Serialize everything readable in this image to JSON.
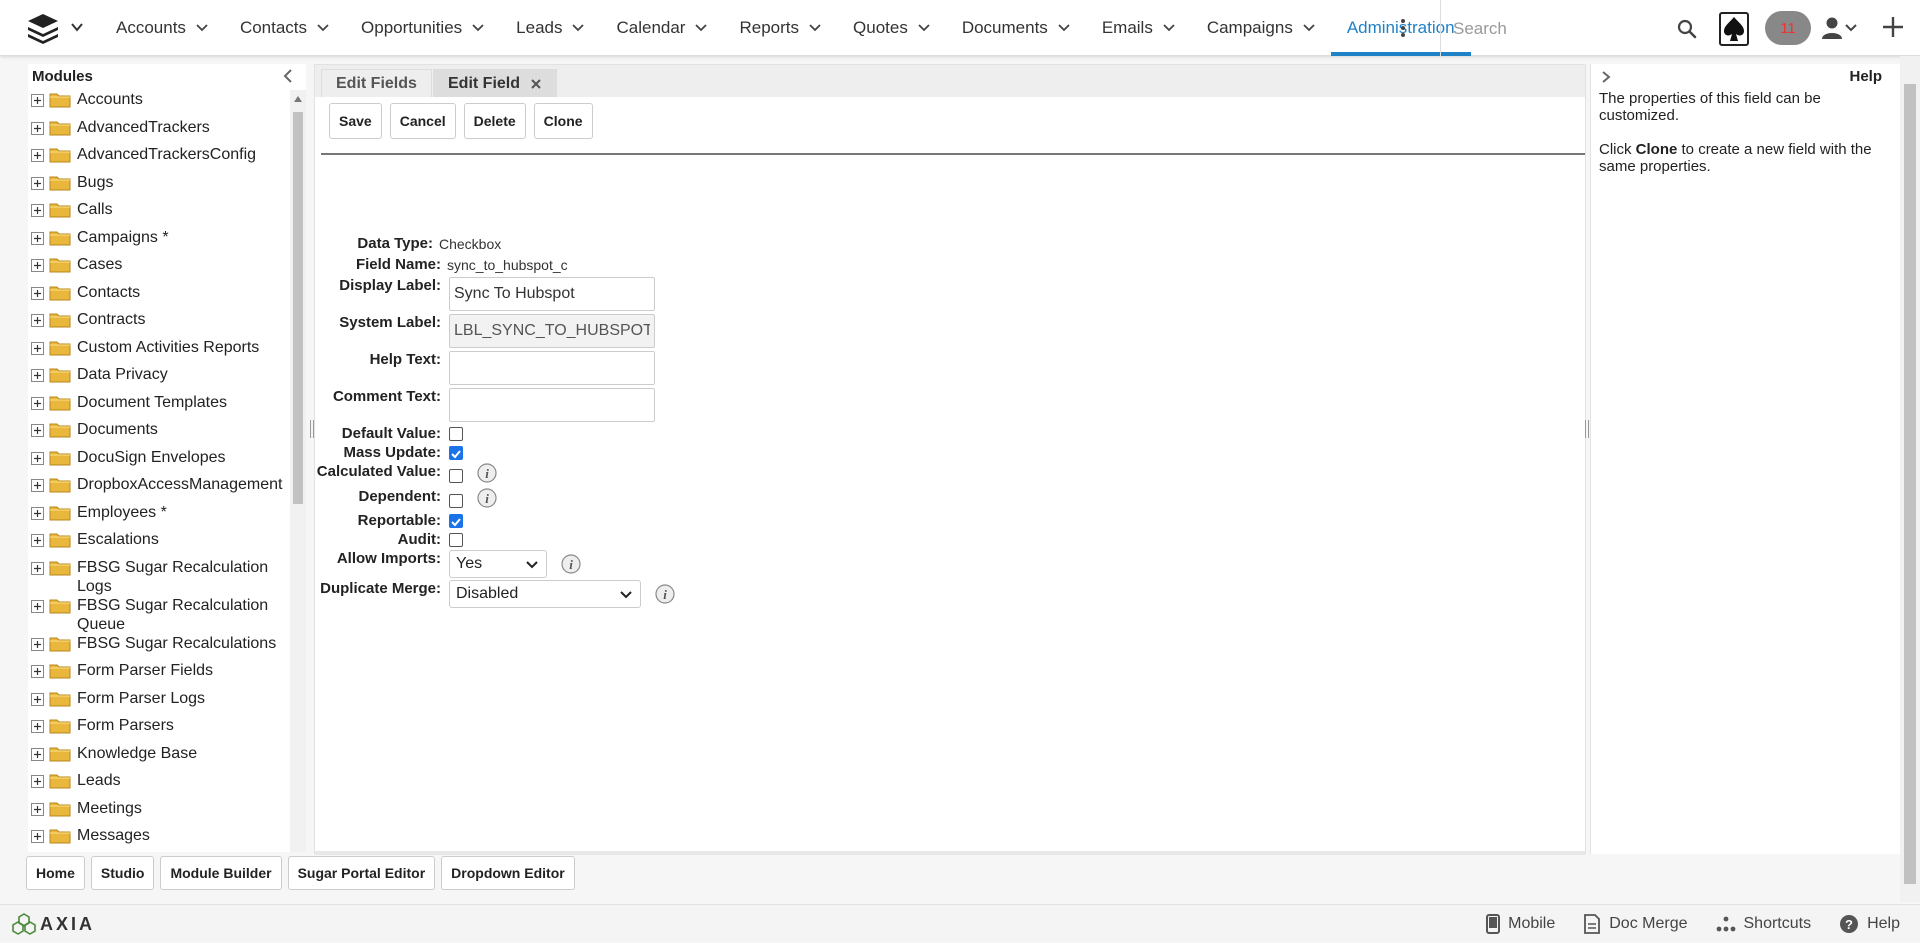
{
  "nav": {
    "items": [
      {
        "label": "Accounts"
      },
      {
        "label": "Contacts"
      },
      {
        "label": "Opportunities"
      },
      {
        "label": "Leads"
      },
      {
        "label": "Calendar"
      },
      {
        "label": "Reports"
      },
      {
        "label": "Quotes"
      },
      {
        "label": "Documents"
      },
      {
        "label": "Emails"
      },
      {
        "label": "Campaigns"
      }
    ],
    "active_label": "Administration",
    "search_placeholder": "Search",
    "notification_count": "11"
  },
  "sidebar": {
    "title": "Modules",
    "items": [
      "Accounts",
      "AdvancedTrackers",
      "AdvancedTrackersConfig",
      "Bugs",
      "Calls",
      "Campaigns *",
      "Cases",
      "Contacts",
      "Contracts",
      "Custom Activities Reports",
      "Data Privacy",
      "Document Templates",
      "Documents",
      "DocuSign Envelopes",
      "DropboxAccessManagement",
      "Employees *",
      "Escalations",
      "FBSG Sugar Recalculation\nLogs",
      "FBSG Sugar Recalculation\nQueue",
      "FBSG Sugar Recalculations",
      "Form Parser Fields",
      "Form Parser Logs",
      "Form Parsers",
      "Knowledge Base",
      "Leads",
      "Meetings",
      "Messages"
    ]
  },
  "tabs": {
    "edit_fields": "Edit Fields",
    "edit_field": "Edit Field"
  },
  "actions": {
    "save": "Save",
    "cancel": "Cancel",
    "delete": "Delete",
    "clone": "Clone"
  },
  "form": {
    "data_type_label": "Data Type:",
    "data_type_value": "Checkbox",
    "field_name_label": "Field Name:",
    "field_name_value": "sync_to_hubspot_c",
    "display_label_label": "Display Label:",
    "display_label_value": "Sync To Hubspot",
    "system_label_label": "System Label:",
    "system_label_value": "LBL_SYNC_TO_HUBSPOT",
    "help_text_label": "Help Text:",
    "comment_text_label": "Comment Text:",
    "default_value_label": "Default Value:",
    "mass_update_label": "Mass Update:",
    "calculated_value_label": "Calculated Value:",
    "dependent_label": "Dependent:",
    "reportable_label": "Reportable:",
    "audit_label": "Audit:",
    "allow_imports_label": "Allow Imports:",
    "allow_imports_value": "Yes",
    "duplicate_merge_label": "Duplicate Merge:",
    "duplicate_merge_value": "Disabled"
  },
  "help": {
    "title": "Help",
    "p1": "The properties of this field can be customized.",
    "p2_pre": "Click ",
    "p2_bold": "Clone",
    "p2_post": " to create a new field with the same properties."
  },
  "bottom_tabs": [
    "Home",
    "Studio",
    "Module Builder",
    "Sugar Portal Editor",
    "Dropdown Editor"
  ],
  "footer": {
    "brand": "AXIA",
    "mobile": "Mobile",
    "doc_merge": "Doc Merge",
    "shortcuts": "Shortcuts",
    "help": "Help"
  },
  "colors": {
    "accent": "#1f82c6",
    "checkbox_checked": "#1a73e8"
  }
}
